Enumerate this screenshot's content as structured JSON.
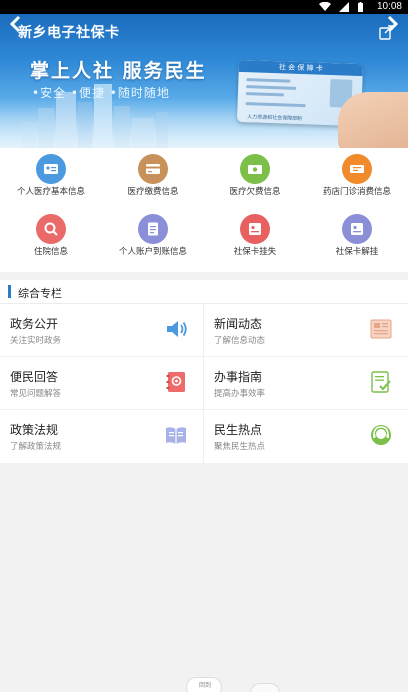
{
  "status_bar": {
    "time": "10:08"
  },
  "header": {
    "app_title": "新乡电子社保卡",
    "slogan": "掌上人社  服务民生",
    "subslogan": "•安全  •便捷  •随时随地",
    "card_title": "社 会 保 障 卡",
    "card_footer": "人力资源和社会保障部制"
  },
  "grid": {
    "items": [
      {
        "label": "个人医疗基本信息",
        "color": "#4b9ae0",
        "icon": "id-card-icon"
      },
      {
        "label": "医疗缴费信息",
        "color": "#c8915a",
        "icon": "payment-card-icon"
      },
      {
        "label": "医疗欠费信息",
        "color": "#7cc04a",
        "icon": "money-icon"
      },
      {
        "label": "药店门诊消费信息",
        "color": "#f08a2a",
        "icon": "ticket-icon"
      },
      {
        "label": "住院信息",
        "color": "#ea6a6a",
        "icon": "hospital-search-icon"
      },
      {
        "label": "个人账户到账信息",
        "color": "#8a8fd8",
        "icon": "document-icon"
      },
      {
        "label": "社保卡挂失",
        "color": "#e86060",
        "icon": "card-lost-icon"
      },
      {
        "label": "社保卡解挂",
        "color": "#8a8fd8",
        "icon": "card-unlock-icon"
      }
    ]
  },
  "section": {
    "title": "综合专栏"
  },
  "tiles": [
    {
      "title": "政务公开",
      "subtitle": "关注实时政务",
      "icon": "speaker-icon"
    },
    {
      "title": "新闻动态",
      "subtitle": "了解信息动态",
      "icon": "newspaper-icon"
    },
    {
      "title": "便民回答",
      "subtitle": "常见问题解答",
      "icon": "contact-book-icon"
    },
    {
      "title": "办事指南",
      "subtitle": "提高办事效率",
      "icon": "checklist-icon"
    },
    {
      "title": "政策法规",
      "subtitle": "了解政策法规",
      "icon": "open-book-icon"
    },
    {
      "title": "民生热点",
      "subtitle": "聚焦民生热点",
      "icon": "support-agent-icon"
    }
  ],
  "bottom": {
    "handle_label": "回到"
  }
}
